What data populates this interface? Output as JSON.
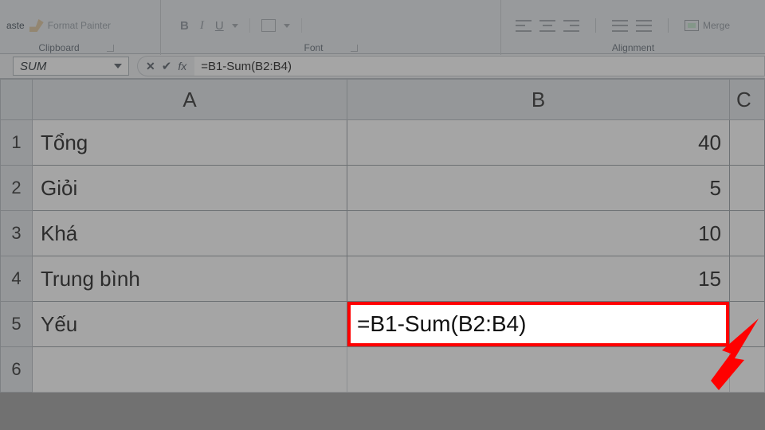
{
  "ribbon": {
    "paste_stub": "aste",
    "format_painter": "Format Painter",
    "group_clipboard": "Clipboard",
    "group_font": "Font",
    "group_alignment": "Alignment",
    "merge": "Merge"
  },
  "formula_bar": {
    "name_box": "SUM",
    "cancel_glyph": "✕",
    "enter_glyph": "✔",
    "fx_label": "fx",
    "formula": "=B1-Sum(B2:B4)"
  },
  "grid": {
    "col_headers": [
      "A",
      "B"
    ],
    "row_headers": [
      "1",
      "2",
      "3",
      "4",
      "5",
      "6"
    ],
    "rows": [
      {
        "a": "Tổng",
        "b": "40"
      },
      {
        "a": "Giỏi",
        "b": "5"
      },
      {
        "a": "Khá",
        "b": "10"
      },
      {
        "a": "Trung bình",
        "b": "15"
      },
      {
        "a": "Yếu",
        "b": "=B1-Sum(B2:B4)"
      }
    ],
    "partial_col": "C"
  }
}
